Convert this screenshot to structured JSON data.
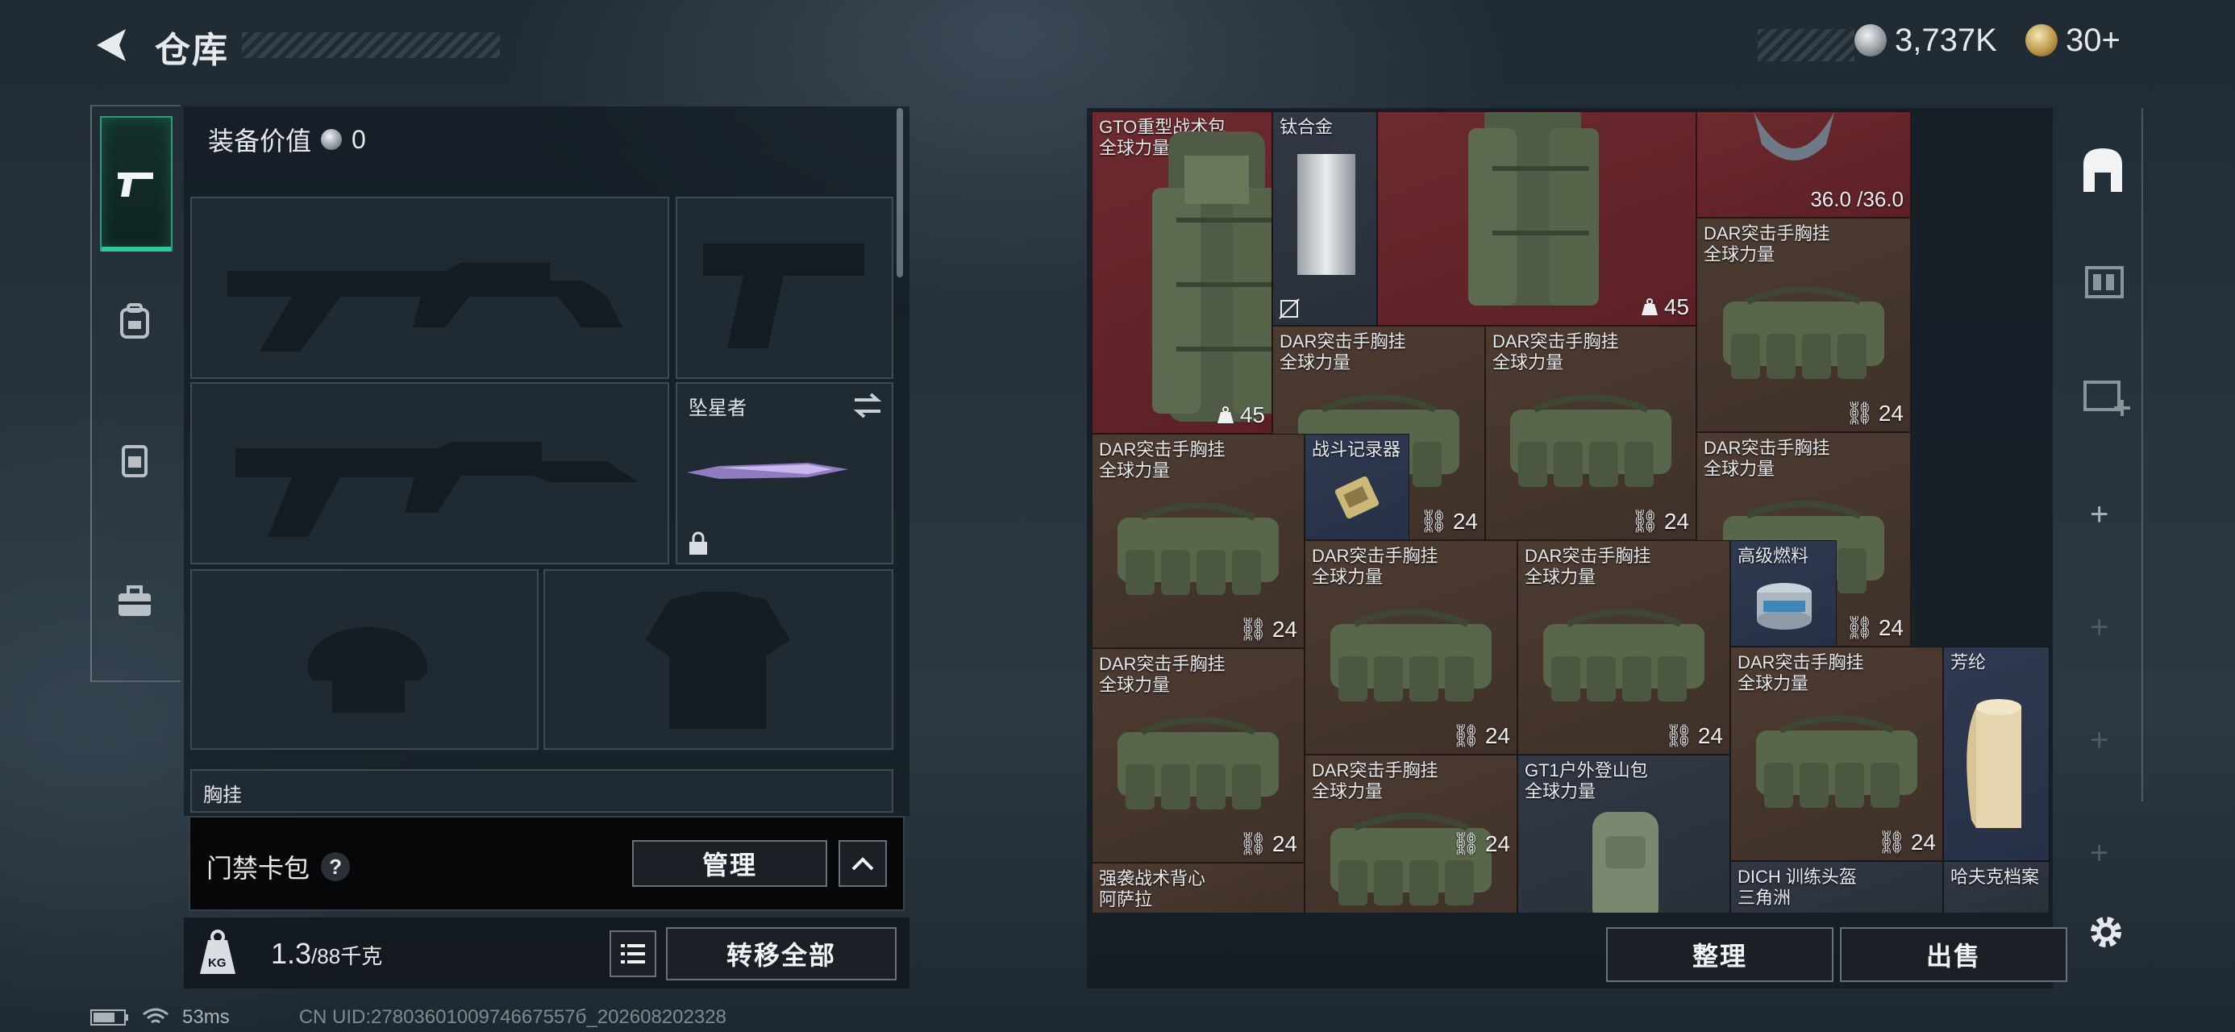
{
  "header": {
    "title": "仓库"
  },
  "currency": {
    "silver": "3,737K",
    "gold": "30+"
  },
  "equipment": {
    "value_label": "装备价值",
    "value": "0",
    "melee_name": "坠星者",
    "chest_label": "胸挂"
  },
  "access_card": {
    "label": "门禁卡包",
    "help": "?",
    "manage": "管理"
  },
  "bottom": {
    "weight": "1.3",
    "weight_cap": "/88千克",
    "kg_icon": "KG",
    "transfer_all": "转移全部"
  },
  "grid_buttons": {
    "sort": "整理",
    "sell": "出售"
  },
  "status": {
    "ping": "53ms",
    "uid": "CN UID:2780360100974667557б_202608202328"
  },
  "items": {
    "gto": {
      "name": "GTO重型战术包",
      "tag": "全球力量",
      "count": "45"
    },
    "titanium": {
      "name": "钛合金"
    },
    "pack2": {
      "count": "45"
    },
    "helmet_top": {
      "durability": "36.0 /36.0"
    },
    "dar": {
      "name": "DAR突击手胸挂",
      "tag": "全球力量",
      "count": "24"
    },
    "recorder": {
      "name": "战斗记录器"
    },
    "fuel": {
      "name": "高级燃料"
    },
    "aramid": {
      "name": "芳纶"
    },
    "gt1": {
      "name": "GT1户外登山包",
      "tag": "全球力量"
    },
    "assault_vest": {
      "name": "强袭战术背心",
      "tag": "阿萨拉"
    },
    "dich": {
      "name": "DICH 训练头盔",
      "tag": "三角洲"
    },
    "hafk": {
      "name": "哈夫克档案"
    }
  }
}
